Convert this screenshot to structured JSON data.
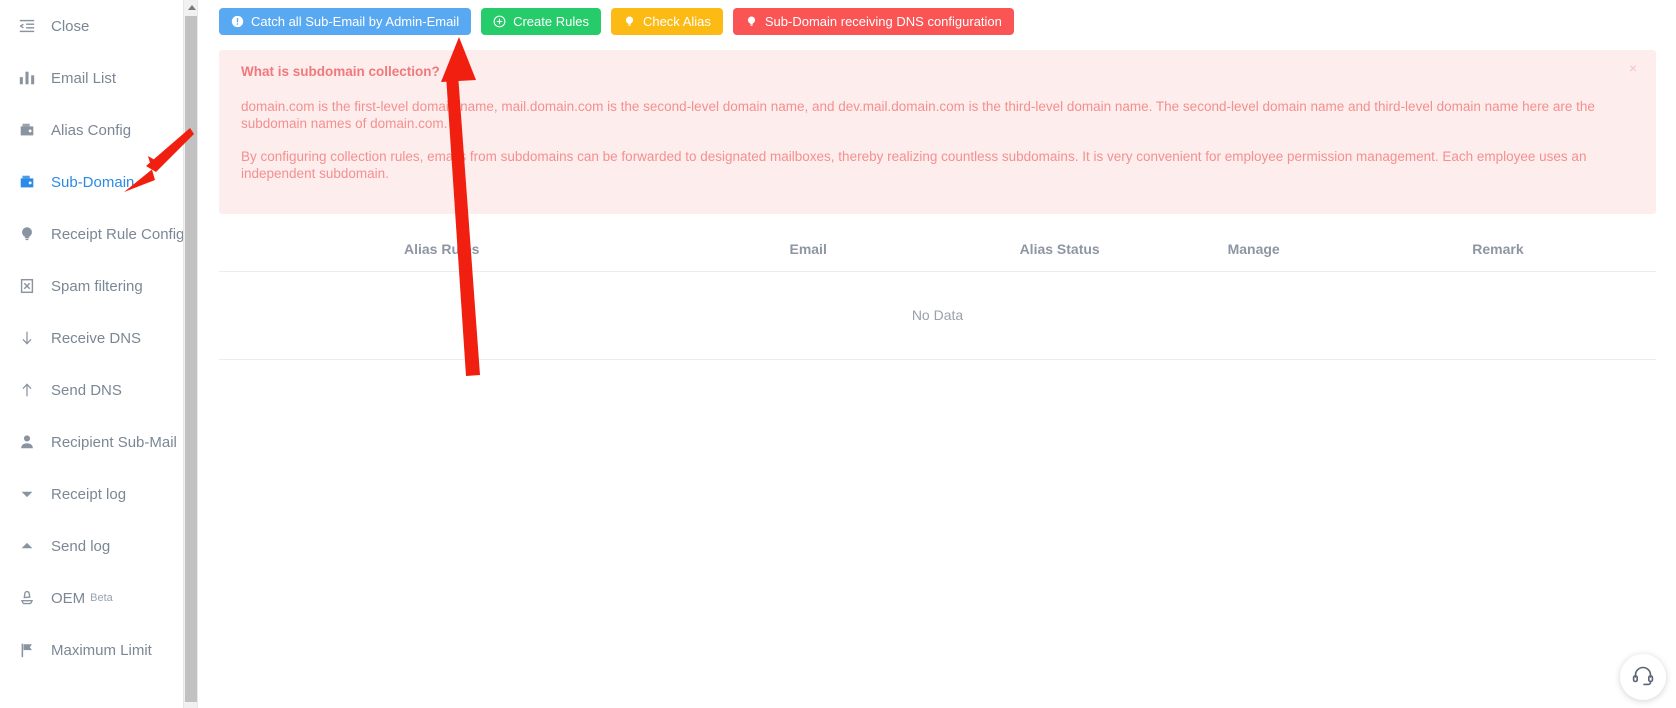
{
  "sidebar": {
    "items": [
      {
        "label": "Close",
        "icon": "menu-fold-icon",
        "active": false,
        "sub": ""
      },
      {
        "label": "Email List",
        "icon": "bar-chart-icon",
        "active": false,
        "sub": ""
      },
      {
        "label": "Alias Config",
        "icon": "wallet-icon",
        "active": false,
        "sub": ""
      },
      {
        "label": "Sub-Domain",
        "icon": "wallet-icon",
        "active": true,
        "sub": ""
      },
      {
        "label": "Receipt Rule Config",
        "icon": "bulb-icon",
        "active": false,
        "sub": ""
      },
      {
        "label": "Spam filtering",
        "icon": "spam-box-icon",
        "active": false,
        "sub": ""
      },
      {
        "label": "Receive DNS",
        "icon": "arrow-down-icon",
        "active": false,
        "sub": ""
      },
      {
        "label": "Send DNS",
        "icon": "arrow-up-icon",
        "active": false,
        "sub": ""
      },
      {
        "label": "Recipient Sub-Mail",
        "icon": "user-icon",
        "active": false,
        "sub": ""
      },
      {
        "label": "Receipt log",
        "icon": "caret-down-icon",
        "active": false,
        "sub": ""
      },
      {
        "label": "Send log",
        "icon": "caret-up-icon",
        "active": false,
        "sub": ""
      },
      {
        "label": "OEM",
        "icon": "stamp-icon",
        "active": false,
        "sub": "Beta"
      },
      {
        "label": "Maximum Limit",
        "icon": "flag-icon",
        "active": false,
        "sub": ""
      }
    ]
  },
  "toolbar": {
    "buttons": [
      {
        "label": "Catch all Sub-Email by Admin-Email",
        "color": "#59a9f2",
        "style": "tbtn-blue",
        "icon": "exclamation-circle-icon"
      },
      {
        "label": "Create Rules",
        "color": "#27cc6a",
        "style": "tbtn-green",
        "icon": "plus-circle-icon"
      },
      {
        "label": "Check Alias",
        "color": "#fcba15",
        "style": "tbtn-yellow",
        "icon": "bulb-icon"
      },
      {
        "label": "Sub-Domain receiving DNS configuration",
        "color": "#fa5455",
        "style": "tbtn-red",
        "icon": "bulb-icon"
      }
    ]
  },
  "alert": {
    "title": "What is subdomain collection?",
    "paragraph1": "domain.com is the first-level domain name, mail.domain.com is the second-level domain name, and dev.mail.domain.com is the third-level domain name. The second-level domain name and third-level domain name here are the subdomain names of domain.com.",
    "paragraph2": "By configuring collection rules, emails from subdomains can be forwarded to designated mailboxes, thereby realizing countless subdomains. It is very convenient for employee permission management. Each employee uses an independent subdomain.",
    "close_label": "×",
    "bg_color": "#fdeded",
    "text_color": "#f4908f"
  },
  "table": {
    "columns": [
      "Alias Rules",
      "Email",
      "Alias Status",
      "Manage",
      "Remark"
    ],
    "rows": [],
    "empty_text": "No Data"
  },
  "support": {
    "icon": "headset-icon"
  }
}
